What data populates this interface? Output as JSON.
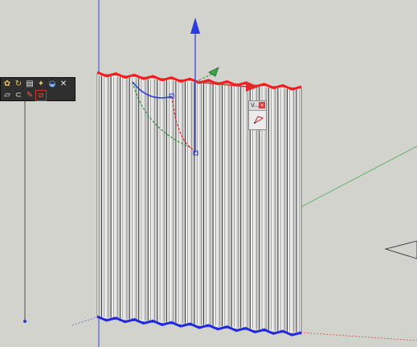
{
  "viewport": {
    "background": "#d3d3ce",
    "corner_label": "",
    "axis_colors": {
      "red": "#e0342b",
      "green": "#3aa84a",
      "blue": "#2e3bd6"
    }
  },
  "toolbar": {
    "buttons": [
      {
        "name": "paint-icon",
        "glyph": "✿",
        "style": "yellow"
      },
      {
        "name": "orbit-icon",
        "glyph": "↻",
        "style": "yellow"
      },
      {
        "name": "document-icon",
        "glyph": "▤",
        "style": "white"
      },
      {
        "name": "wand-icon",
        "glyph": "✦",
        "style": "yellow"
      },
      {
        "name": "drop-icon",
        "glyph": "◒",
        "style": "blue"
      },
      {
        "name": "cross-icon",
        "glyph": "✕",
        "style": "white"
      },
      {
        "name": "shape-icon",
        "glyph": "▱",
        "style": "white"
      },
      {
        "name": "lasso-icon",
        "glyph": "⊂",
        "style": "white"
      },
      {
        "name": "pencil-icon",
        "glyph": "✎",
        "style": "red"
      },
      {
        "name": "edge-icon",
        "glyph": "⧄",
        "style": "red"
      }
    ]
  },
  "mini_window": {
    "title": "V...",
    "close_glyph": "×",
    "tool_icon": "polygon-tool-icon"
  }
}
